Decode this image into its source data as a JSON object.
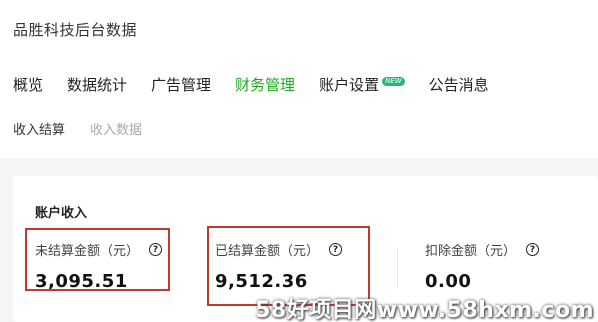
{
  "app": {
    "title": "品胜科技后台数据"
  },
  "tabs": [
    {
      "label": "概览"
    },
    {
      "label": "数据统计"
    },
    {
      "label": "广告管理"
    },
    {
      "label": "财务管理"
    },
    {
      "label": "账户设置",
      "badge": "NEW"
    },
    {
      "label": "公告消息"
    }
  ],
  "subtabs": [
    {
      "label": "收入结算"
    },
    {
      "label": "收入数据"
    }
  ],
  "income": {
    "title": "账户收入",
    "unsettled": {
      "label": "未结算金额（元）",
      "value": "3,095.51"
    },
    "settled": {
      "label": "已结算金额（元）",
      "value": "9,512.36"
    },
    "deducted": {
      "label": "扣除金额（元）",
      "value": "0.00"
    }
  },
  "watermark": "58好项目网www.58hxm.com",
  "colors": {
    "accent": "#1aad19",
    "highlight": "#c0392b"
  }
}
